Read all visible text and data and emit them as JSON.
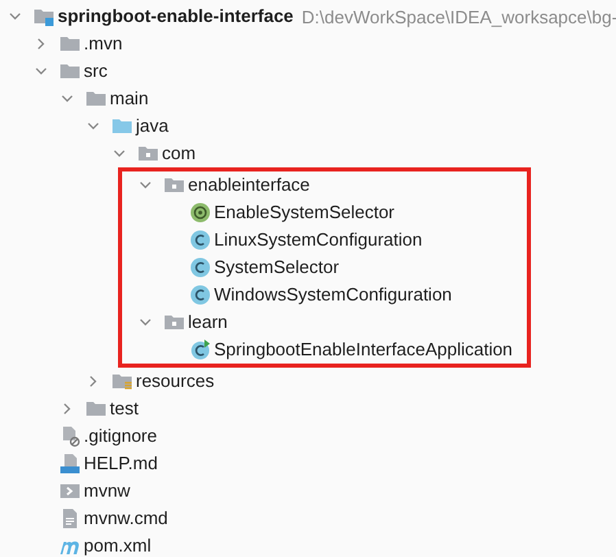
{
  "project_tree": {
    "root": {
      "label": "springboot-enable-interface",
      "path": "D:\\devWorkSpace\\IDEA_worksapce\\bg-",
      "kind": "module",
      "expanded": true,
      "children": [
        {
          "label": ".mvn",
          "kind": "folder",
          "expanded": false
        },
        {
          "label": "src",
          "kind": "folder",
          "expanded": true,
          "children": [
            {
              "label": "main",
              "kind": "folder",
              "expanded": true,
              "children": [
                {
                  "label": "java",
                  "kind": "source-folder",
                  "expanded": true,
                  "children": [
                    {
                      "label": "com",
                      "kind": "package",
                      "expanded": true,
                      "highlight_children": true,
                      "children": [
                        {
                          "label": "enableinterface",
                          "kind": "package",
                          "expanded": true,
                          "children": [
                            {
                              "label": "EnableSystemSelector",
                              "kind": "annotation"
                            },
                            {
                              "label": "LinuxSystemConfiguration",
                              "kind": "class"
                            },
                            {
                              "label": "SystemSelector",
                              "kind": "class"
                            },
                            {
                              "label": "WindowsSystemConfiguration",
                              "kind": "class"
                            }
                          ]
                        },
                        {
                          "label": "learn",
                          "kind": "package",
                          "expanded": true,
                          "children": [
                            {
                              "label": "SpringbootEnableInterfaceApplication",
                              "kind": "app-class"
                            }
                          ]
                        }
                      ]
                    }
                  ]
                },
                {
                  "label": "resources",
                  "kind": "resources-folder",
                  "expanded": false
                }
              ]
            },
            {
              "label": "test",
              "kind": "folder",
              "expanded": false
            }
          ]
        },
        {
          "label": ".gitignore",
          "kind": "ignore-file"
        },
        {
          "label": "HELP.md",
          "kind": "markdown-file"
        },
        {
          "label": "mvnw",
          "kind": "script-file"
        },
        {
          "label": "mvnw.cmd",
          "kind": "text-file"
        },
        {
          "label": "pom.xml",
          "kind": "pom-file"
        }
      ]
    }
  }
}
